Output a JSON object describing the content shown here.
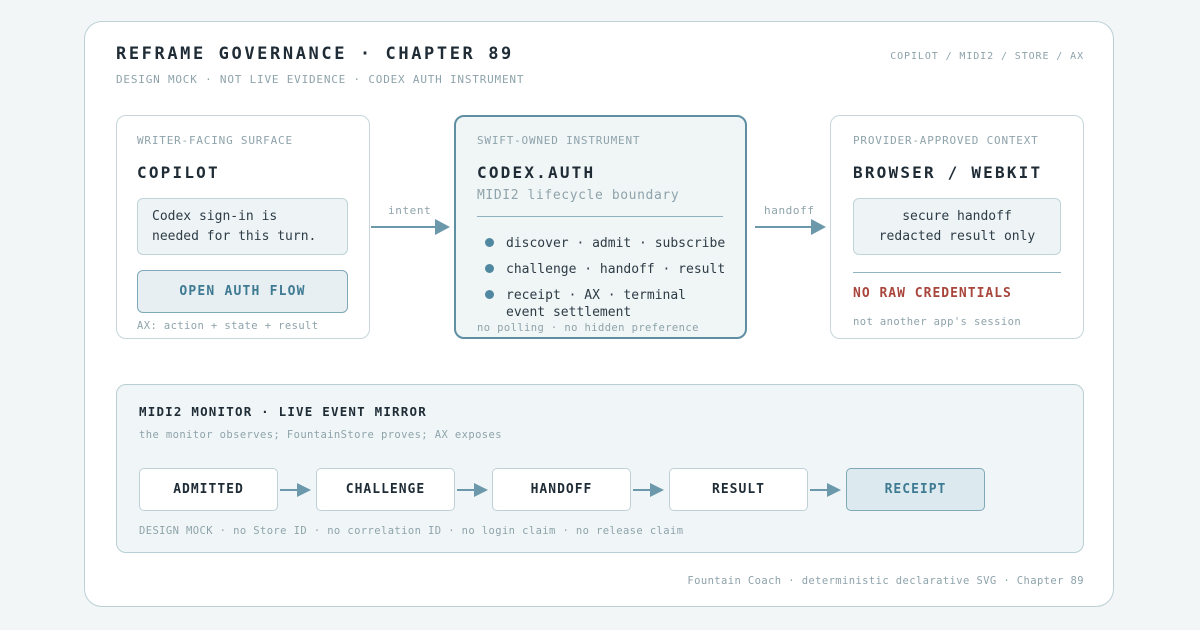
{
  "header": {
    "title": "REFRAME GOVERNANCE · CHAPTER 89",
    "subtitle": "DESIGN MOCK · NOT LIVE EVIDENCE · CODEX AUTH INSTRUMENT",
    "breadcrumb": "COPILOT / MIDI2 / STORE / AX"
  },
  "copilot": {
    "eyebrow": "WRITER-FACING SURFACE",
    "heading": "COPILOT",
    "note_line1": "Codex sign-in is",
    "note_line2": "needed for this turn.",
    "button_label": "OPEN AUTH FLOW",
    "footer": "AX: action + state + result"
  },
  "arrow_labels": {
    "intent": "intent",
    "handoff": "handoff"
  },
  "codex": {
    "eyebrow": "SWIFT-OWNED INSTRUMENT",
    "heading": "CODEX.AUTH",
    "subheading": "MIDI2 lifecycle boundary",
    "bullets": [
      "discover · admit · subscribe",
      "challenge · handoff · result",
      "receipt · AX · terminal event settlement"
    ],
    "bullet3_line1": "receipt · AX · terminal",
    "bullet3_line2": "event settlement",
    "footer": "no polling · no hidden preference"
  },
  "browser": {
    "eyebrow": "PROVIDER-APPROVED CONTEXT",
    "heading": "BROWSER / WEBKIT",
    "note_line1": "secure handoff",
    "note_line2": "redacted result only",
    "warning": "NO RAW CREDENTIALS",
    "footer": "not another app's session"
  },
  "monitor": {
    "heading": "MIDI2 MONITOR · LIVE EVENT MIRROR",
    "caption": "the monitor observes; FountainStore proves; AX exposes",
    "steps": [
      "ADMITTED",
      "CHALLENGE",
      "HANDOFF",
      "RESULT",
      "RECEIPT"
    ],
    "active_step": "RECEIPT",
    "footer": "DESIGN MOCK · no Store ID · no correlation ID · no login claim · no release claim"
  },
  "footer": "Fountain Coach · deterministic declarative SVG · Chapter 89",
  "colors": {
    "accent": "#4f88a0",
    "warning": "#a8463c",
    "border": "#bcd0d6",
    "text": "#1f2c36",
    "muted": "#8ea3ab"
  }
}
